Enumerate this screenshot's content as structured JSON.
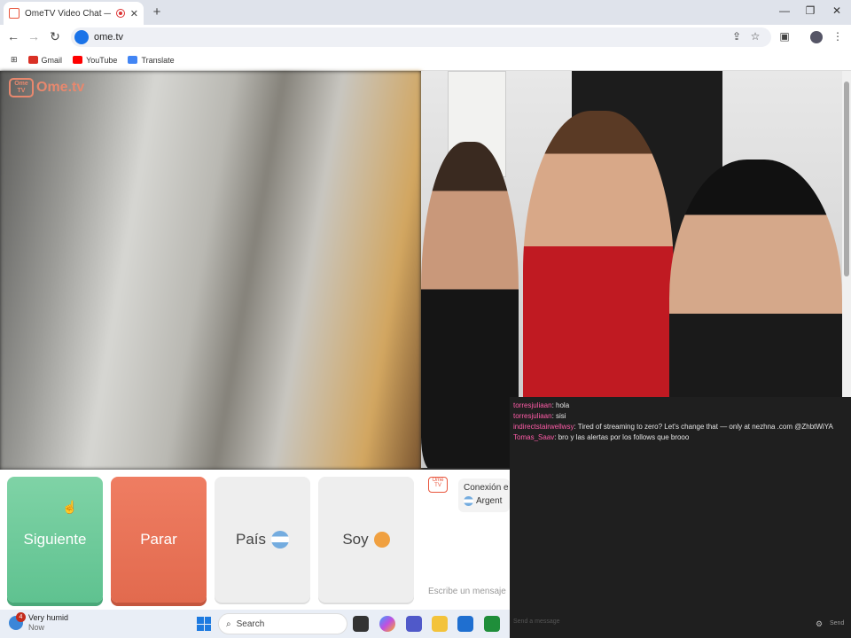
{
  "browser": {
    "tab_title": "OmeTV Video Chat — Ome",
    "new_tab": "+",
    "url": "ome.tv",
    "window_controls": [
      "—",
      "❐",
      "✕"
    ],
    "bookmarks": [
      {
        "label": "Gmail",
        "color": "#d93025"
      },
      {
        "label": "YouTube",
        "color": "#ff0000"
      },
      {
        "label": "Translate",
        "color": "#4285f4"
      }
    ]
  },
  "site": {
    "logo_text": "Ome.tv",
    "logo_tv_text": "Ome TV"
  },
  "controls": {
    "siguiente": "Siguiente",
    "parar": "Parar",
    "pais": "País",
    "soy": "Soy"
  },
  "sysmsg": {
    "bubble_line1": "Conexión e",
    "bubble_line2": "Argent",
    "input_placeholder": "Escribe un mensaje"
  },
  "chat": {
    "messages": [
      {
        "user": "torresjuliaan",
        "text": ": hola"
      },
      {
        "user": "torresjuliaan",
        "text": ": sisi"
      },
      {
        "user": "indirectstairwellwsy",
        "text": ": Tired of streaming to zero? Let's change that — only at nezhna .com @ZhbtWiYA"
      },
      {
        "user": "Tomas_Saav",
        "text": ": bro y las alertas por los follows que brooo"
      }
    ],
    "input_placeholder": "Send a message",
    "send_label": "Send"
  },
  "taskbar": {
    "weather_badge": "4",
    "weather_title": "Very humid",
    "weather_sub": "Now",
    "search_label": "Search"
  },
  "colors": {
    "siguiente": "#6fcb9a",
    "parar": "#e8735a",
    "chat_user": "#ff5ca8",
    "accent": "#e8553c"
  }
}
